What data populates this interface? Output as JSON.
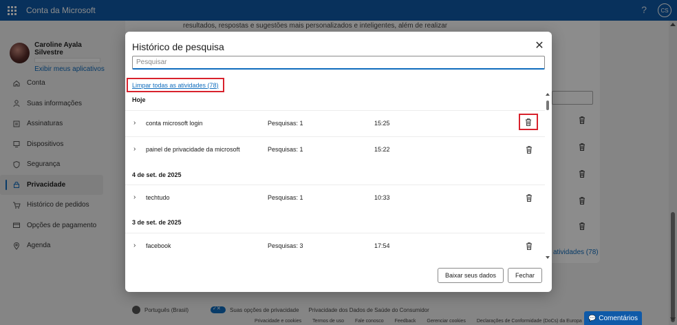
{
  "topbar": {
    "app_title": "Conta da Microsoft",
    "help_label": "?",
    "avatar_initials": "CS"
  },
  "sidebar": {
    "user_name": "Caroline Ayala Silvestre",
    "apps_link": "Exibir meus aplicativos",
    "items": [
      {
        "label": "Conta",
        "icon": "home-icon"
      },
      {
        "label": "Suas informações",
        "icon": "person-icon"
      },
      {
        "label": "Assinaturas",
        "icon": "subscriptions-icon"
      },
      {
        "label": "Dispositivos",
        "icon": "laptop-icon"
      },
      {
        "label": "Segurança",
        "icon": "shield-icon"
      },
      {
        "label": "Privacidade",
        "icon": "lock-icon",
        "active": true
      },
      {
        "label": "Histórico de pedidos",
        "icon": "cart-icon"
      },
      {
        "label": "Opções de pagamento",
        "icon": "credit-card-icon"
      },
      {
        "label": "Agenda",
        "icon": "location-icon"
      }
    ]
  },
  "background": {
    "text": "resultados, respostas e sugestões mais personalizados e inteligentes, além de realizar",
    "clear_link": "atividades (78)"
  },
  "modal": {
    "title": "Histórico de pesquisa",
    "search_placeholder": "Pesquisar",
    "clear_all": "Limpar todas as atividades (78)",
    "groups": [
      {
        "date": "Hoje",
        "rows": [
          {
            "query": "conta microsoft login",
            "count": "Pesquisas: 1",
            "time": "15:25"
          },
          {
            "query": "painel de privacidade da microsoft",
            "count": "Pesquisas: 1",
            "time": "15:22"
          }
        ]
      },
      {
        "date": "4 de set. de 2025",
        "rows": [
          {
            "query": "techtudo",
            "count": "Pesquisas: 1",
            "time": "10:33"
          }
        ]
      },
      {
        "date": "3 de set. de 2025",
        "rows": [
          {
            "query": "facebook",
            "count": "Pesquisas: 3",
            "time": "17:54"
          }
        ]
      }
    ],
    "download_button": "Baixar seus dados",
    "close_button": "Fechar"
  },
  "footer": {
    "language": "Português (Brasil)",
    "privacy_choices": "Suas opções de privacidade",
    "health_privacy": "Privacidade dos Dados de Saúde do Consumidor",
    "links": [
      "Privacidade e cookies",
      "Termos de uso",
      "Fale conosco",
      "Feedback",
      "Gerenciar cookies",
      "Declarações de Conformidade (DoCs) da Europa"
    ],
    "feedback_button": "Comentários"
  },
  "colors": {
    "accent": "#0f6cbd",
    "topbar": "#0f5aa8",
    "highlight": "#d8212c"
  }
}
